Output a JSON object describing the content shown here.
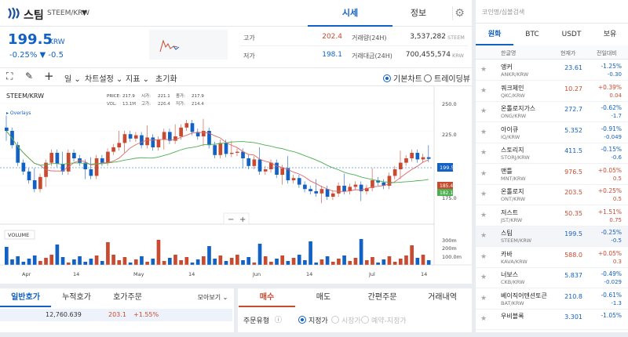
{
  "colors": {
    "up": "#c84a31",
    "down": "#1261c4",
    "accent": "#1261c4",
    "ma_red": "#e06666",
    "ma_green": "#4caf50"
  },
  "header": {
    "coin_name": "스팀",
    "coin_symbol": "STEEM/KRW",
    "tabs": [
      "시세",
      "정보"
    ]
  },
  "price": {
    "current": "199.5",
    "unit": "KRW",
    "change": "-0.25% ▼ -0.5"
  },
  "stats": {
    "high_label": "고가",
    "high_value": "202.4",
    "low_label": "저가",
    "low_value": "198.1",
    "volume_label": "거래량(24H)",
    "volume_value": "3,537,282",
    "volume_unit": "STEEM",
    "amount_label": "거래대금(24H)",
    "amount_value": "700,455,574",
    "amount_unit": "KRW"
  },
  "toolbar": {
    "period": "일",
    "chart_settings": "차트설정",
    "indicators": "지표",
    "reset": "초기화",
    "basic_chart": "기본차트",
    "trading_view": "트레이딩뷰"
  },
  "chart": {
    "symbol": "STEEM/KRW",
    "ohlc_labels": [
      "PRICE:",
      "217.9",
      "시가:",
      "221.1",
      "종가:",
      "217.9"
    ],
    "ohlc_labels2": [
      "VOL:",
      "13.1M",
      "고가:",
      "226.4",
      "저가:",
      "214.4"
    ],
    "overlays": "Overlays",
    "volume_label": "VOLUME",
    "price_ticks": [
      "250.0",
      "225.0",
      "200.0",
      "175.0"
    ],
    "volume_ticks": [
      "300m",
      "200m",
      "100.0m"
    ],
    "x_ticks": [
      "Apr",
      "14",
      "May",
      "14",
      "Jun",
      "14",
      "Jul",
      "14"
    ],
    "current_tag": "199.5",
    "ma_tag1": "185.4",
    "ma_tag2": "182.1",
    "zoom_minus": "−",
    "zoom_plus": "+"
  },
  "chart_data": {
    "type": "candlestick",
    "y_range": [
      140,
      260
    ],
    "current_price": 199.5,
    "approx_closes_sequence_description_free": [
      225,
      212,
      196,
      188,
      180,
      172,
      183,
      196,
      205,
      195,
      188,
      205,
      200,
      196,
      190,
      184,
      200,
      196,
      206,
      210,
      214,
      222,
      218,
      221,
      212,
      219,
      210,
      217,
      224,
      216,
      220,
      228,
      232,
      224,
      220,
      225,
      212,
      203,
      214,
      204,
      205,
      206,
      200,
      193,
      199,
      188,
      190,
      196,
      185,
      191,
      180,
      182,
      176,
      172,
      170,
      168,
      172,
      165,
      168,
      175,
      170,
      174,
      176,
      170,
      173,
      180,
      178,
      175,
      184,
      190,
      196,
      200,
      205,
      199,
      201,
      199.5
    ]
  },
  "bottom": {
    "left_tabs": [
      "일반호가",
      "누적호가",
      "호가주문"
    ],
    "view_all": "모아보기",
    "order_tabs": [
      "매수",
      "매도",
      "간편주문",
      "거래내역"
    ],
    "order_book_amount": "12,760.639",
    "order_book_price": "203.1",
    "order_book_pct": "+1.55%",
    "order_type_label": "주문유형",
    "order_types": [
      "지정가",
      "시장가",
      "예약-지정가"
    ]
  },
  "market": {
    "search_placeholder": "코인명/심볼검색",
    "tabs": [
      "원화",
      "BTC",
      "USDT",
      "보유"
    ],
    "columns": [
      "한글명",
      "현재가",
      "전일대비"
    ],
    "rows": [
      {
        "name": "앵커",
        "symbol": "ANKR/KRW",
        "price": "23.61",
        "pct": "-1.25%",
        "diff": "-0.30",
        "dir": "down"
      },
      {
        "name": "쿼크체인",
        "symbol": "QKC/KRW",
        "price": "10.27",
        "pct": "+0.39%",
        "diff": "0.04",
        "dir": "up"
      },
      {
        "name": "온톨로지가스",
        "symbol": "ONG/KRW",
        "price": "272.7",
        "pct": "-0.62%",
        "diff": "-1.7",
        "dir": "down"
      },
      {
        "name": "아이큐",
        "symbol": "IQ/KRW",
        "price": "5.352",
        "pct": "-0.91%",
        "diff": "-0.049",
        "dir": "down"
      },
      {
        "name": "스토리지",
        "symbol": "STORJ/KRW",
        "price": "411.5",
        "pct": "-0.15%",
        "diff": "-0.6",
        "dir": "down"
      },
      {
        "name": "맨틀",
        "symbol": "MNT/KRW",
        "price": "976.5",
        "pct": "+0.05%",
        "diff": "0.5",
        "dir": "up"
      },
      {
        "name": "온톨로지",
        "symbol": "ONT/KRW",
        "price": "203.5",
        "pct": "+0.25%",
        "diff": "0.5",
        "dir": "up"
      },
      {
        "name": "저스트",
        "symbol": "JST/KRW",
        "price": "50.35",
        "pct": "+1.51%",
        "diff": "0.75",
        "dir": "up"
      },
      {
        "name": "스팀",
        "symbol": "STEEM/KRW",
        "price": "199.5",
        "pct": "-0.25%",
        "diff": "-0.5",
        "dir": "down"
      },
      {
        "name": "카바",
        "symbol": "KAVA/KRW",
        "price": "588.0",
        "pct": "+0.05%",
        "diff": "0.3",
        "dir": "up"
      },
      {
        "name": "너보스",
        "symbol": "CKB/KRW",
        "price": "5.837",
        "pct": "-0.49%",
        "diff": "-0.029",
        "dir": "down"
      },
      {
        "name": "베이직어텐션토큰",
        "symbol": "BAT/KRW",
        "price": "210.8",
        "pct": "-0.61%",
        "diff": "-1.3",
        "dir": "down"
      },
      {
        "name": "우비블록",
        "symbol": "",
        "price": "3.301",
        "pct": "-1.05%",
        "diff": "",
        "dir": "down"
      }
    ]
  }
}
